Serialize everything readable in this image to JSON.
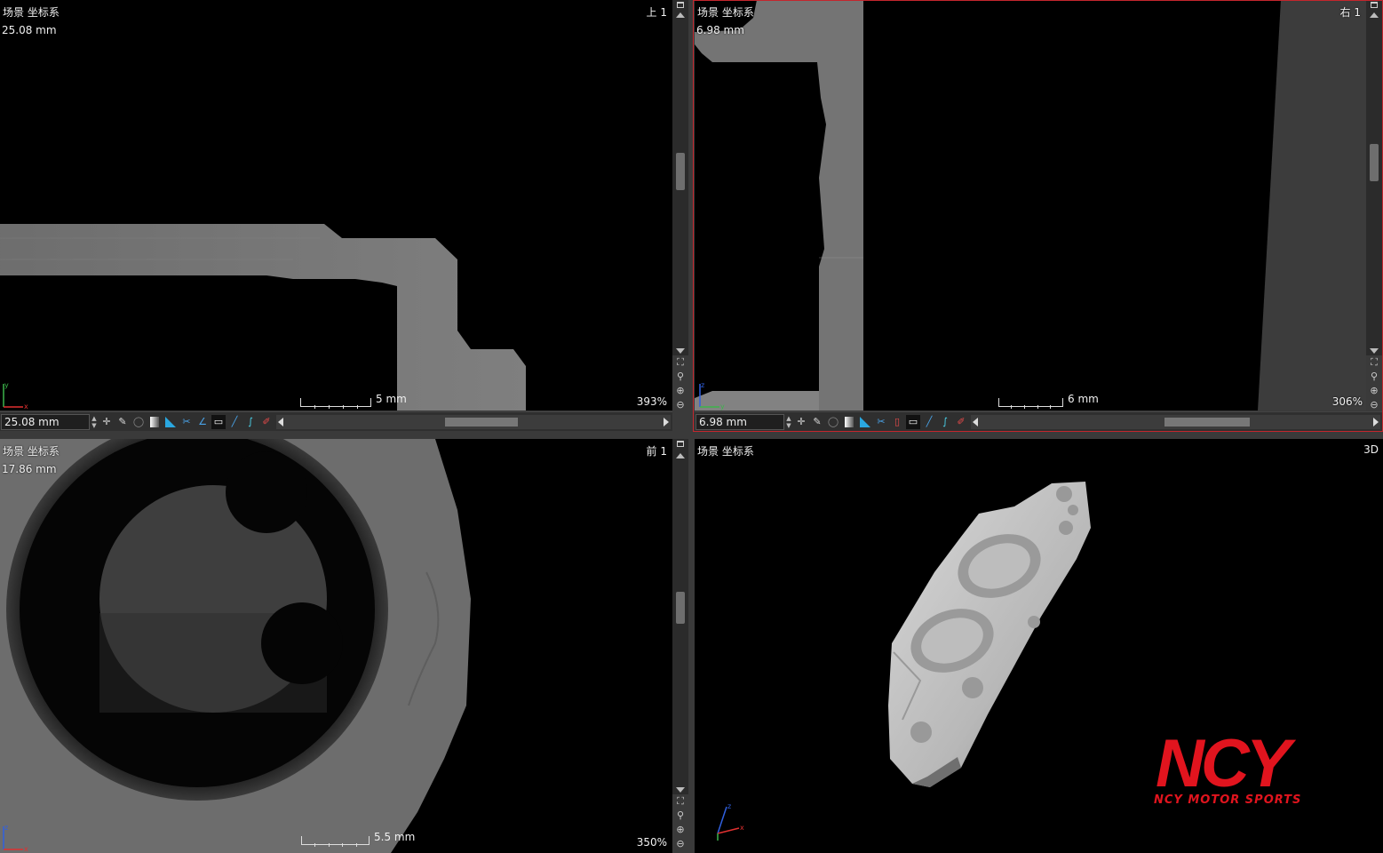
{
  "viewports": {
    "top": {
      "scene_label": "场景 坐标系",
      "depth": "25.08 mm",
      "view_name": "上 1",
      "scale": "5 mm",
      "zoom": "393%",
      "depth_input": "25.08 mm"
    },
    "right": {
      "scene_label": "场景 坐标系",
      "depth": "6.98 mm",
      "view_name": "右 1",
      "scale": "6 mm",
      "zoom": "306%",
      "depth_input": "6.98 mm"
    },
    "front": {
      "scene_label": "场景 坐标系",
      "depth": "17.86 mm",
      "view_name": "前 1",
      "scale": "5.5 mm",
      "zoom": "350%"
    },
    "three_d": {
      "scene_label": "场景 坐标系",
      "view_name": "3D"
    }
  },
  "axis_labels": {
    "x": "x",
    "y": "y",
    "z": "z"
  },
  "logo": {
    "main": "NCY",
    "sub": "NCY MOTOR SPORTS"
  },
  "colors": {
    "active_border": "#c4262d",
    "logo_red": "#e1141e",
    "panel_bg": "#000000",
    "chrome_bg": "#3a3a3a"
  },
  "icons": {
    "toolbar": [
      "spin-arrows-icon",
      "crosshair-icon",
      "pen-icon",
      "circle-icon",
      "grayscale-icon",
      "color-ramp-icon",
      "scissors-icon",
      "angle-icon",
      "ruler-icon",
      "curve-icon",
      "spline-icon",
      "paint-icon"
    ],
    "side_tools": [
      "fit-view-icon",
      "zoom-icon",
      "zoom-in-icon",
      "zoom-out-icon"
    ]
  }
}
